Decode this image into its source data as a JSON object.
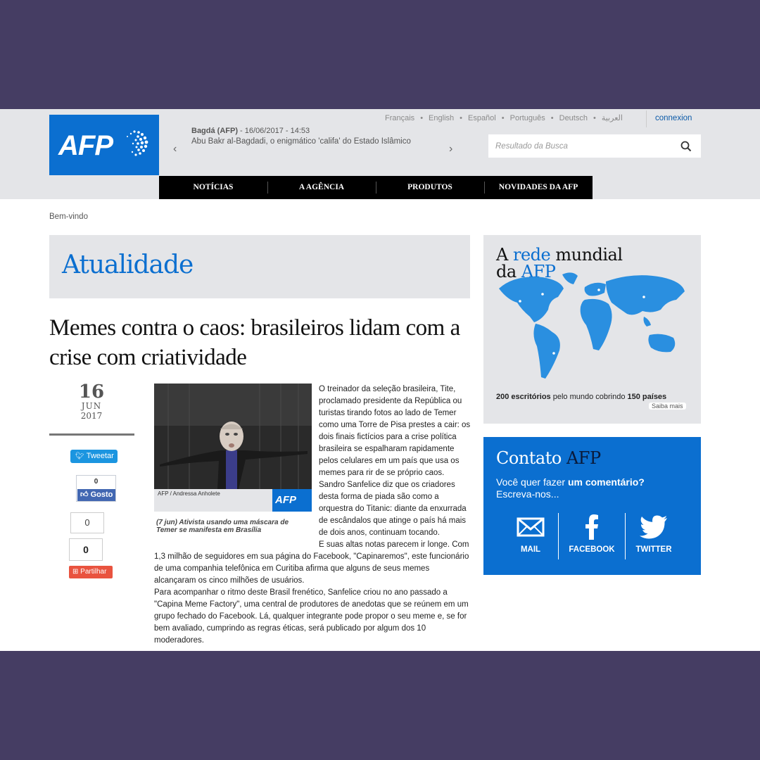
{
  "header": {
    "logo_text": "AFP",
    "ticker": {
      "source": "Bagdá (AFP)",
      "date": " - 16/06/2017 - 14:53",
      "headline": "Abu Bakr al-Bagdadi, o enigmático 'califa' do Estado Islâmico",
      "prev_icon": "chevron-left-icon",
      "next_icon": "chevron-right-icon"
    },
    "languages": [
      "Français",
      "English",
      "Español",
      "Português",
      "Deutsch",
      "العربية"
    ],
    "connexion": "connexion",
    "search": {
      "placeholder": "Resultado da Busca",
      "icon": "search-icon"
    },
    "nav": [
      "NOTÍCIAS",
      "A AGÊNCIA",
      "PRODUTOS",
      "NOVIDADES DA AFP"
    ]
  },
  "breadcrumb": "Bem-vindo",
  "section_title": "Atualidade",
  "article": {
    "title": "Memes contra o caos: brasileiros lidam com a crise com criatividade",
    "date": {
      "day": "16",
      "month": "JUN",
      "year": "2017"
    },
    "social": {
      "tweet": "Tweetar",
      "like_count": "0",
      "like": "Gosto",
      "share_count_1": "0",
      "share_count_2": "0",
      "share": "Partilhar"
    },
    "photo": {
      "credit": "AFP / Andressa Anholete",
      "badge": "AFP",
      "caption": "(7 jun) Ativista usando uma máscara de Temer se manifesta em Brasília"
    },
    "paragraphs": [
      "O treinador da seleção brasileira, Tite, proclamado presidente da República ou turistas tirando fotos ao lado de Temer como uma Torre de Pisa prestes a cair: os dois finais fictícios para a crise política brasileira se espalharam rapidamente pelos celulares em um país que usa os memes para rir de se próprio caos.",
      "Sandro Sanfelice diz que os criadores desta forma de piada são como a orquestra do Titanic: diante da enxurrada de escândalos que atinge o país há mais de dois anos, continuam tocando.",
      "E suas altas notas parecem ir longe. Com 1,3 milhão de seguidores em sua página do Facebook, \"Capinaremos\", este funcionário de uma companhia telefônica em Curitiba afirma que alguns de seus memes alcançaram os cinco milhões de usuários.",
      "Para acompanhar o ritmo deste Brasil frenético, Sanfelice criou no ano passado a \"Capina Meme Factory\", uma central de produtores de anedotas que se reúnem em um grupo fechado do Facebook. Lá, qualquer integrante pode propor o seu meme e, se for bem avaliado, cumprindo as regras éticas, será publicado por algum dos 10 moderadores."
    ]
  },
  "sidebar": {
    "network": {
      "title_a": "A ",
      "title_rede": "rede",
      "title_mundial": " mundial",
      "title_da": "da ",
      "title_afp": "AFP",
      "offices": "200 escritórios",
      "stats_mid": " pelo mundo cobrindo ",
      "countries": "150 países",
      "more": "Saiba mais"
    },
    "contact": {
      "title_a": "Contato ",
      "title_b": "AFP",
      "sub_a": "Você quer fazer ",
      "sub_b": "um comentário?",
      "sub_c": "Escreva-nos...",
      "options": [
        "MAIL",
        "FACEBOOK",
        "TWITTER"
      ]
    }
  },
  "colors": {
    "background": "#453d63",
    "brand_blue": "#0b6fd0",
    "header_gray": "#e4e5e8",
    "nav": "#000000"
  }
}
